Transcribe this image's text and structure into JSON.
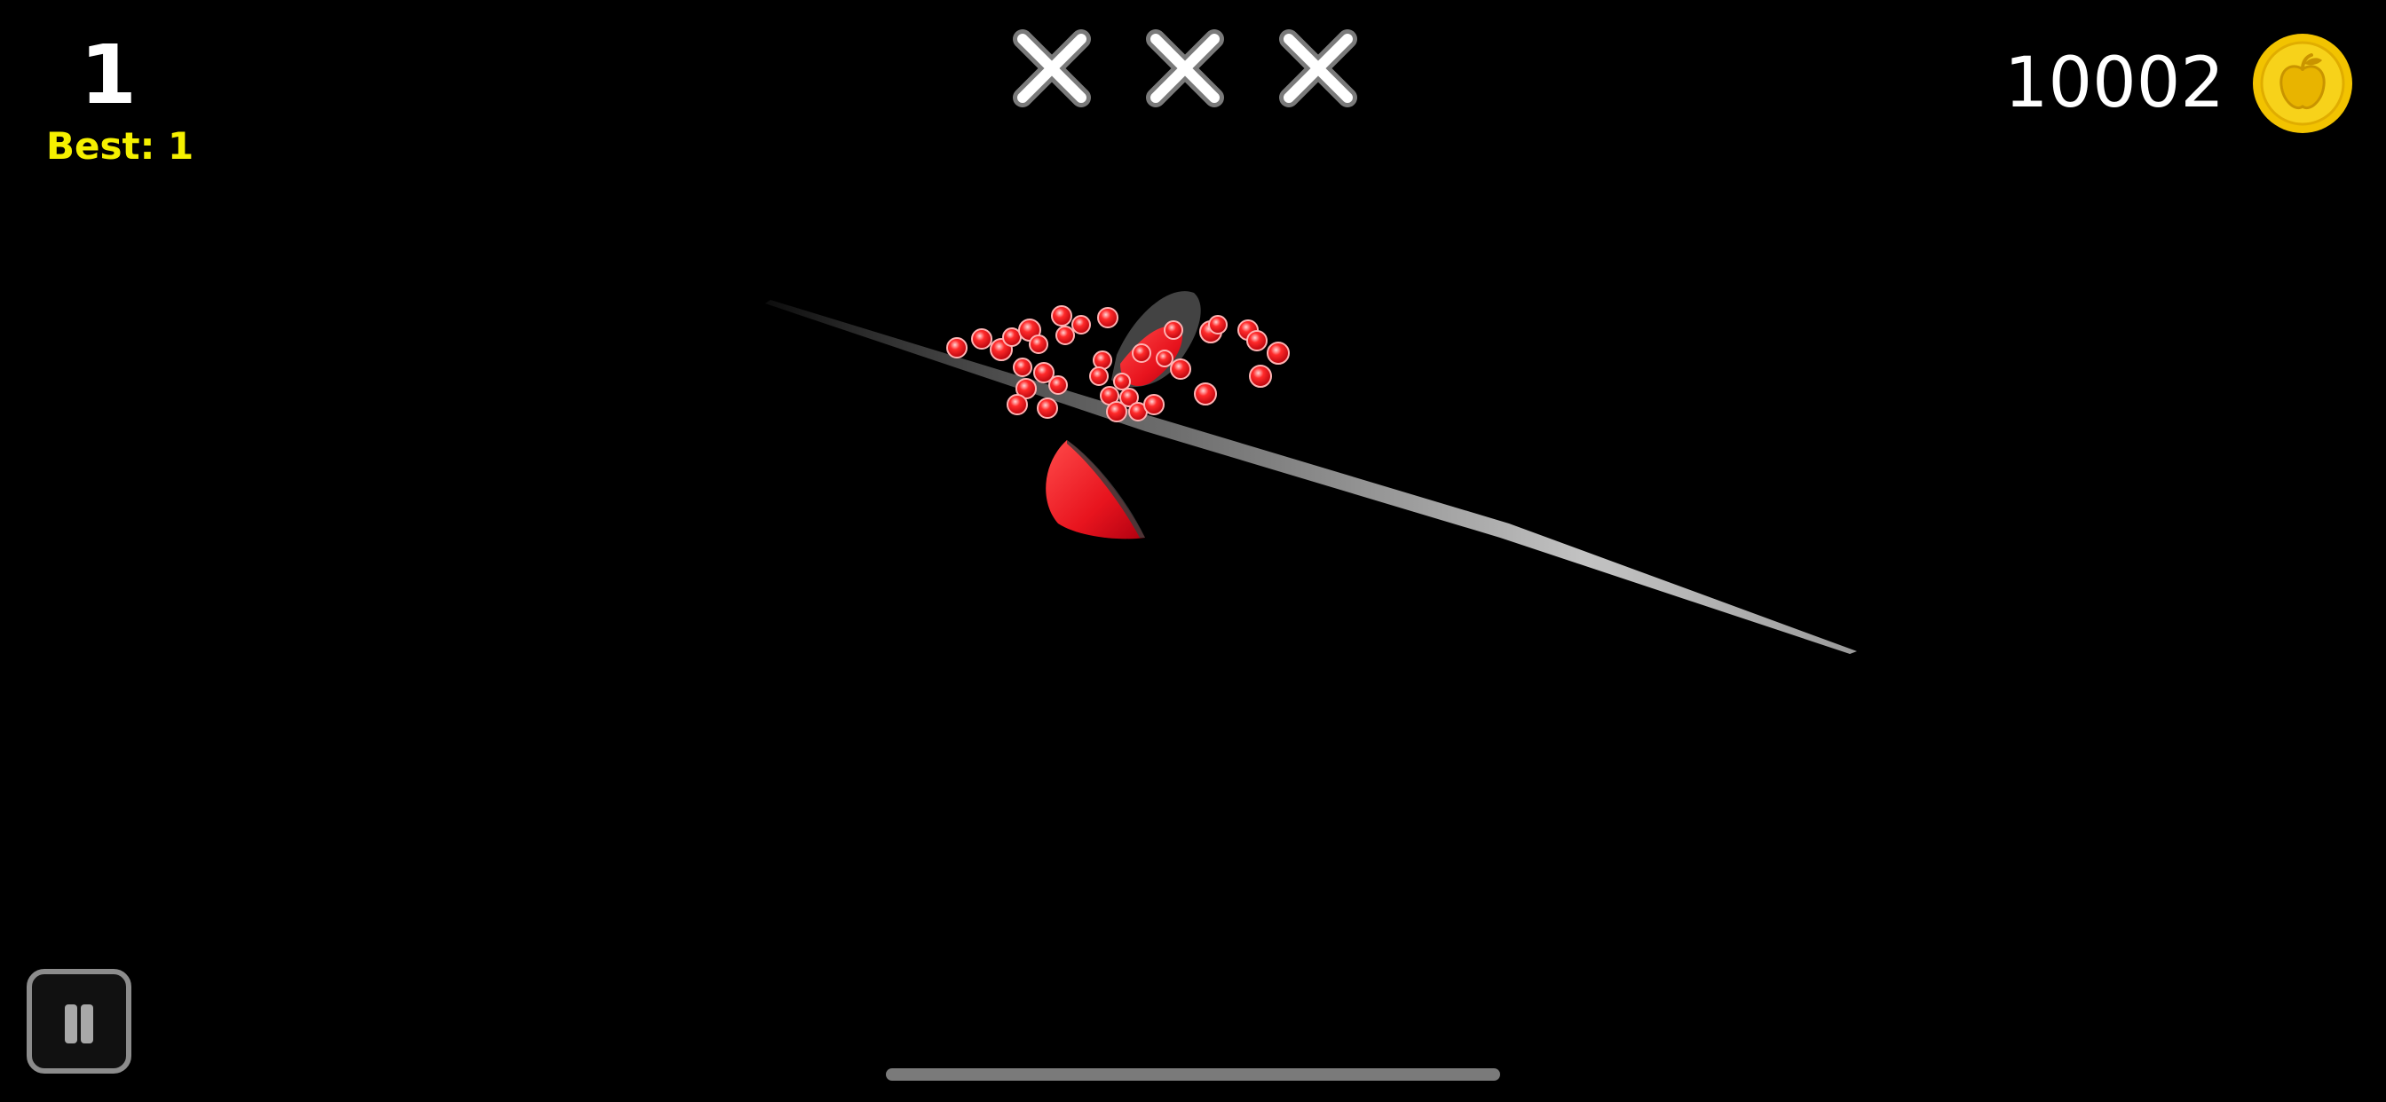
{
  "hud": {
    "score": "1",
    "best": "Best: 1",
    "coins": "10002",
    "strikes": [
      "x-mark",
      "x-mark",
      "x-mark"
    ],
    "coin_icon": "gold-apple-coin-icon",
    "pause_icon": "pause-icon"
  },
  "colors": {
    "background": "#000000",
    "best_text": "#f5f000",
    "juice": "#e8141e",
    "coin": "#f2c300"
  },
  "scene": {
    "objects": [
      "sliced-fruit-top-half",
      "sliced-fruit-bottom-half",
      "juice-splash",
      "blade-trail"
    ]
  }
}
